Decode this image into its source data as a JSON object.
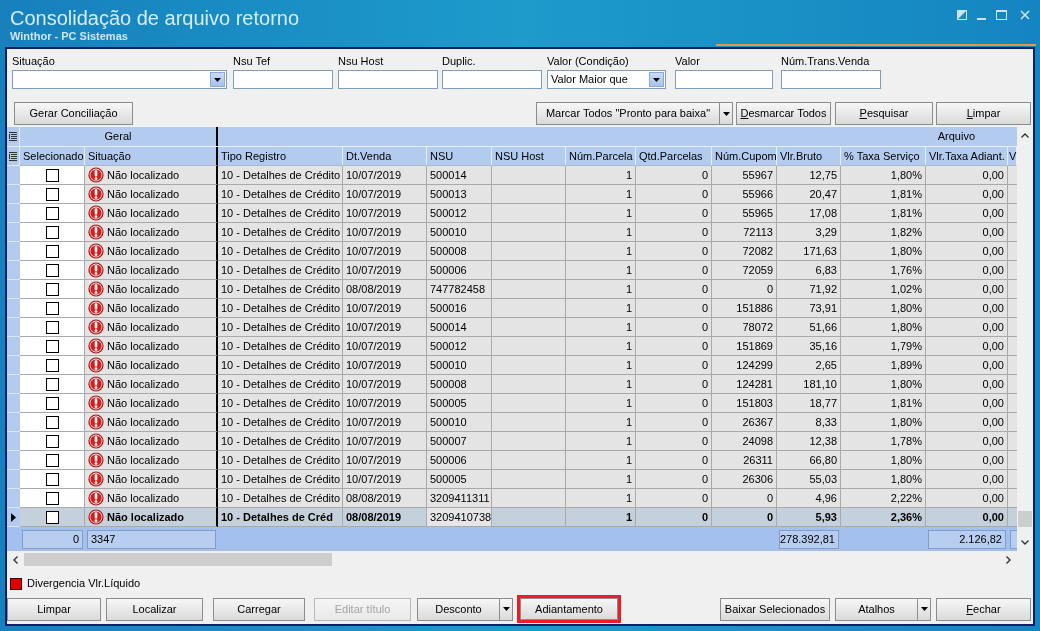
{
  "window": {
    "title": "Consolidação de arquivo retorno",
    "subtitle": "Winthor - PC Sistemas"
  },
  "filters": [
    {
      "label": "Situação",
      "kind": "dropdown"
    },
    {
      "label": "Nsu Tef",
      "kind": "text"
    },
    {
      "label": "Nsu Host",
      "kind": "text"
    },
    {
      "label": "Duplic.",
      "kind": "text"
    },
    {
      "label": "Valor (Condição)",
      "kind": "dropdown",
      "value": "Valor Maior que"
    },
    {
      "label": "Valor",
      "kind": "text"
    },
    {
      "label": "Núm.Trans.Venda",
      "kind": "text"
    }
  ],
  "toolbar": {
    "left": [
      {
        "label": "Gerar Conciliação",
        "kind": "plain",
        "mnemonic": false
      }
    ],
    "right": [
      {
        "label": "Marcar Todos \"Pronto para baixa\"",
        "kind": "split",
        "mnemonic": false
      },
      {
        "label": "Desmarcar Todos",
        "kind": "plain",
        "mnemonic": true
      },
      {
        "label": "Pesquisar",
        "kind": "plain",
        "mnemonic": true
      },
      {
        "label": "Limpar",
        "kind": "plain",
        "mnemonic": true
      }
    ]
  },
  "grid": {
    "bands": [
      "Geral",
      "Arquivo"
    ],
    "columns": [
      "Selecionado",
      "Situação",
      "Tipo Registro",
      "Dt.Venda",
      "NSU",
      "NSU Host",
      "Núm.Parcela",
      "Qtd.Parcelas",
      "Núm.Cupom",
      "Vlr.Bruto",
      "% Taxa Serviço",
      "Vlr.Taxa Adiant.",
      "V"
    ],
    "rows": [
      {
        "selected": false,
        "checked": false,
        "kind": "error",
        "cells": [
          "",
          "Não localizado",
          "10 - Detalhes de Crédito",
          "10/07/2019",
          "500014",
          "",
          "1",
          "0",
          "55967",
          "12,75",
          "1,80%",
          "0,00"
        ]
      },
      {
        "selected": false,
        "checked": false,
        "kind": "error",
        "cells": [
          "",
          "Não localizado",
          "10 - Detalhes de Crédito",
          "10/07/2019",
          "500013",
          "",
          "1",
          "0",
          "55966",
          "20,47",
          "1,81%",
          "0,00"
        ]
      },
      {
        "selected": false,
        "checked": false,
        "kind": "error",
        "cells": [
          "",
          "Não localizado",
          "10 - Detalhes de Crédito",
          "10/07/2019",
          "500012",
          "",
          "1",
          "0",
          "55965",
          "17,08",
          "1,81%",
          "0,00"
        ]
      },
      {
        "selected": false,
        "checked": false,
        "kind": "error",
        "cells": [
          "",
          "Não localizado",
          "10 - Detalhes de Crédito",
          "10/07/2019",
          "500010",
          "",
          "1",
          "0",
          "72113",
          "3,29",
          "1,82%",
          "0,00"
        ]
      },
      {
        "selected": false,
        "checked": false,
        "kind": "error",
        "cells": [
          "",
          "Não localizado",
          "10 - Detalhes de Crédito",
          "10/07/2019",
          "500008",
          "",
          "1",
          "0",
          "72082",
          "171,63",
          "1,80%",
          "0,00"
        ]
      },
      {
        "selected": false,
        "checked": false,
        "kind": "error",
        "cells": [
          "",
          "Não localizado",
          "10 - Detalhes de Crédito",
          "10/07/2019",
          "500006",
          "",
          "1",
          "0",
          "72059",
          "6,83",
          "1,76%",
          "0,00"
        ]
      },
      {
        "selected": false,
        "checked": false,
        "kind": "error",
        "cells": [
          "",
          "Não localizado",
          "10 - Detalhes de Crédito",
          "08/08/2019",
          "747782458",
          "",
          "1",
          "0",
          "0",
          "71,92",
          "1,02%",
          "0,00"
        ]
      },
      {
        "selected": false,
        "checked": false,
        "kind": "error",
        "cells": [
          "",
          "Não localizado",
          "10 - Detalhes de Crédito",
          "10/07/2019",
          "500016",
          "",
          "1",
          "0",
          "151886",
          "73,91",
          "1,80%",
          "0,00"
        ]
      },
      {
        "selected": false,
        "checked": false,
        "kind": "error",
        "cells": [
          "",
          "Não localizado",
          "10 - Detalhes de Crédito",
          "10/07/2019",
          "500014",
          "",
          "1",
          "0",
          "78072",
          "51,66",
          "1,80%",
          "0,00"
        ]
      },
      {
        "selected": false,
        "checked": false,
        "kind": "error",
        "cells": [
          "",
          "Não localizado",
          "10 - Detalhes de Crédito",
          "10/07/2019",
          "500012",
          "",
          "1",
          "0",
          "151869",
          "35,16",
          "1,79%",
          "0,00"
        ]
      },
      {
        "selected": false,
        "checked": false,
        "kind": "error",
        "cells": [
          "",
          "Não localizado",
          "10 - Detalhes de Crédito",
          "10/07/2019",
          "500010",
          "",
          "1",
          "0",
          "124299",
          "2,65",
          "1,89%",
          "0,00"
        ]
      },
      {
        "selected": false,
        "checked": false,
        "kind": "error",
        "cells": [
          "",
          "Não localizado",
          "10 - Detalhes de Crédito",
          "10/07/2019",
          "500008",
          "",
          "1",
          "0",
          "124281",
          "181,10",
          "1,80%",
          "0,00"
        ]
      },
      {
        "selected": false,
        "checked": false,
        "kind": "error",
        "cells": [
          "",
          "Não localizado",
          "10 - Detalhes de Crédito",
          "10/07/2019",
          "500005",
          "",
          "1",
          "0",
          "151803",
          "18,77",
          "1,81%",
          "0,00"
        ]
      },
      {
        "selected": false,
        "checked": false,
        "kind": "error",
        "cells": [
          "",
          "Não localizado",
          "10 - Detalhes de Crédito",
          "10/07/2019",
          "500010",
          "",
          "1",
          "0",
          "26367",
          "8,33",
          "1,80%",
          "0,00"
        ]
      },
      {
        "selected": false,
        "checked": false,
        "kind": "error",
        "cells": [
          "",
          "Não localizado",
          "10 - Detalhes de Crédito",
          "10/07/2019",
          "500007",
          "",
          "1",
          "0",
          "24098",
          "12,38",
          "1,78%",
          "0,00"
        ]
      },
      {
        "selected": false,
        "checked": false,
        "kind": "error",
        "cells": [
          "",
          "Não localizado",
          "10 - Detalhes de Crédito",
          "10/07/2019",
          "500006",
          "",
          "1",
          "0",
          "26311",
          "66,80",
          "1,80%",
          "0,00"
        ]
      },
      {
        "selected": false,
        "checked": false,
        "kind": "error",
        "cells": [
          "",
          "Não localizado",
          "10 - Detalhes de Crédito",
          "10/07/2019",
          "500005",
          "",
          "1",
          "0",
          "26306",
          "55,03",
          "1,80%",
          "0,00"
        ]
      },
      {
        "selected": false,
        "checked": false,
        "kind": "error",
        "cells": [
          "",
          "Não localizado",
          "10 - Detalhes de Crédito",
          "08/08/2019",
          "3209411311",
          "",
          "1",
          "0",
          "0",
          "4,96",
          "2,22%",
          "0,00"
        ]
      },
      {
        "selected": true,
        "checked": false,
        "kind": "error",
        "cells": [
          "",
          "Não localizado",
          "10 - Detalhes de Créd",
          "08/08/2019",
          {
            "text": "3209410738",
            "focused": true
          },
          "",
          "1",
          "0",
          "0",
          "5,93",
          "2,36%",
          "0,00"
        ]
      }
    ],
    "totals": [
      "0",
      "3347",
      "278.392,81",
      "2.126,82"
    ]
  },
  "legend": [
    {
      "label": "Divergencia Vlr.Líquido",
      "color": "#e00000"
    }
  ],
  "actions_left": [
    {
      "label": "Limpar",
      "kind": "plain",
      "mnemonic": false,
      "disabled": false,
      "highlighted": false
    },
    {
      "label": "Localizar",
      "kind": "plain",
      "mnemonic": false,
      "disabled": false,
      "highlighted": false
    },
    {
      "label": "Carregar",
      "kind": "plain",
      "mnemonic": false,
      "disabled": false,
      "highlighted": false
    },
    {
      "label": "Editar título",
      "kind": "plain",
      "mnemonic": false,
      "disabled": true,
      "highlighted": false
    },
    {
      "label": "Desconto",
      "kind": "split",
      "mnemonic": false,
      "disabled": false,
      "highlighted": false
    },
    {
      "label": "Adiantamento",
      "kind": "plain",
      "mnemonic": false,
      "disabled": false,
      "highlighted": true
    }
  ],
  "actions_right": [
    {
      "label": "Baixar Selecionados",
      "kind": "plain",
      "mnemonic": false,
      "disabled": false,
      "highlighted": false
    },
    {
      "label": "Atalhos",
      "kind": "split",
      "mnemonic": false,
      "disabled": false,
      "highlighted": false
    },
    {
      "label": "Fechar",
      "kind": "plain",
      "mnemonic": true,
      "disabled": false,
      "highlighted": false
    }
  ]
}
